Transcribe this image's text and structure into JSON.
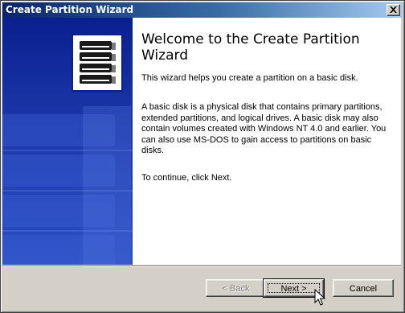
{
  "window": {
    "title": "Create Partition Wizard",
    "close_icon": "close-icon"
  },
  "welcome": {
    "heading": "Welcome to the Create Partition Wizard",
    "intro": "This wizard helps you create a partition on a basic disk.",
    "description": "A basic disk is a physical disk that contains primary partitions, extended partitions, and logical drives. A basic disk may also contain volumes created with Windows NT 4.0 and earlier. You can also use MS-DOS to gain access to partitions on basic disks.",
    "instruction": "To continue, click Next."
  },
  "buttons": {
    "back": "< Back",
    "next": "Next >",
    "cancel": "Cancel"
  },
  "colors": {
    "titlebar_start": "#0a246a",
    "titlebar_end": "#a6caf0",
    "sidebar": "#1a36a8",
    "dialog_face": "#d4d0c8"
  },
  "icons": [
    "disk-stack-icon",
    "close-icon",
    "mouse-cursor-icon"
  ]
}
